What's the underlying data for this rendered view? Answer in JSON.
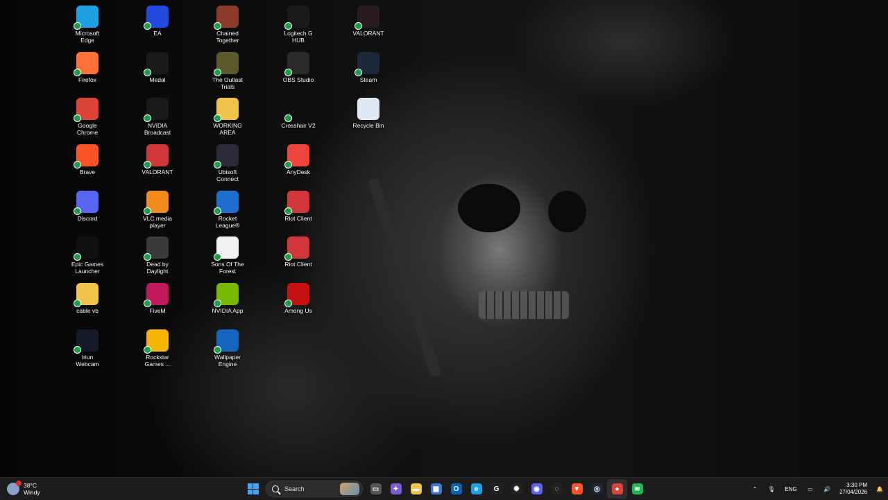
{
  "desktop": {
    "icons": [
      {
        "label": "Microsoft\nEdge",
        "icon": "edge-icon",
        "color": "#1fa0e3"
      },
      {
        "label": "Firefox",
        "icon": "firefox-icon",
        "color": "#ff7139"
      },
      {
        "label": "Google\nChrome",
        "icon": "chrome-icon",
        "color": "#db4437"
      },
      {
        "label": "Brave",
        "icon": "brave-icon",
        "color": "#fb542b"
      },
      {
        "label": "Discord",
        "icon": "discord-icon",
        "color": "#5865f2"
      },
      {
        "label": "Epic Games\nLauncher",
        "icon": "epic-games-icon",
        "color": "#111111"
      },
      {
        "label": "cable vb",
        "icon": "folder-icon",
        "color": "#f0c44a"
      },
      {
        "label": "Iriun\nWebcam",
        "icon": "webcam-icon",
        "color": "#141a2a"
      },
      {
        "label": "EA",
        "icon": "ea-icon",
        "color": "#2349e0"
      },
      {
        "label": "Medal",
        "icon": "medal-icon",
        "color": "#1a1a1a"
      },
      {
        "label": "NVIDIA\nBroadcast",
        "icon": "nvidia-broadcast-icon",
        "color": "#1a1a1a"
      },
      {
        "label": "VALORANT",
        "icon": "riot-icon",
        "color": "#d13639"
      },
      {
        "label": "VLC media\nplayer",
        "icon": "vlc-icon",
        "color": "#f28b1c"
      },
      {
        "label": "Dead by\nDaylight",
        "icon": "dead-by-daylight-icon",
        "color": "#3a3a3a"
      },
      {
        "label": "FiveM",
        "icon": "fivem-icon",
        "color": "#c2185b"
      },
      {
        "label": "Rockstar\nGames ...",
        "icon": "rockstar-icon",
        "color": "#f4b400"
      },
      {
        "label": "Chained\nTogether",
        "icon": "chained-together-icon",
        "color": "#8a3b2a"
      },
      {
        "label": "The Outlast\nTrials",
        "icon": "outlast-trials-icon",
        "color": "#5c5a2c"
      },
      {
        "label": "WORKING\nAREA",
        "icon": "folder-icon",
        "color": "#f0c44a"
      },
      {
        "label": "Ubisoft\nConnect",
        "icon": "ubisoft-icon",
        "color": "#2a2a3a"
      },
      {
        "label": "Rocket\nLeague®",
        "icon": "rocket-league-icon",
        "color": "#1f6fd1"
      },
      {
        "label": "Sons Of The\nForest",
        "icon": "file-icon",
        "color": "#f2f2f2"
      },
      {
        "label": "NVIDIA App",
        "icon": "nvidia-icon",
        "color": "#76b900"
      },
      {
        "label": "Wallpaper\nEngine",
        "icon": "wallpaper-engine-icon",
        "color": "#1565c0"
      },
      {
        "label": "Logitech G\nHUB",
        "icon": "logitech-icon",
        "color": "#1a1a1a"
      },
      {
        "label": "OBS Studio",
        "icon": "obs-icon",
        "color": "#2b2b2b"
      },
      {
        "label": "Crosshair V2",
        "icon": "crosshair-icon",
        "color": "#0f0f0f"
      },
      {
        "label": "AnyDesk",
        "icon": "anydesk-icon",
        "color": "#ef443b"
      },
      {
        "label": "Riot Client",
        "icon": "riot-icon",
        "color": "#d13639"
      },
      {
        "label": "Riot Client",
        "icon": "riot-icon",
        "color": "#d13639"
      },
      {
        "label": "Among Us",
        "icon": "among-us-icon",
        "color": "#c51111"
      },
      {
        "label": "VALORANT",
        "icon": "valorant-icon",
        "color": "#2a1a22"
      },
      {
        "label": "Steam",
        "icon": "steam-icon",
        "color": "#1b2838"
      },
      {
        "label": "Recycle Bin",
        "icon": "recycle-bin-icon",
        "color": "#dfe9f3"
      }
    ]
  },
  "taskbar": {
    "weather": {
      "temp": "38°C",
      "condition": "Windy"
    },
    "search_label": "Search",
    "pinned": [
      {
        "name": "task-view",
        "glyph": "▭",
        "color": "#555555"
      },
      {
        "name": "copilot",
        "glyph": "✦",
        "color": "#7b5cd6"
      },
      {
        "name": "file-explorer",
        "glyph": "▬",
        "color": "#f0c44a"
      },
      {
        "name": "microsoft-store",
        "glyph": "▦",
        "color": "#3a7bd5"
      },
      {
        "name": "outlook",
        "glyph": "O",
        "color": "#0a64c2"
      },
      {
        "name": "edge",
        "glyph": "e",
        "color": "#1fa0e3"
      },
      {
        "name": "logitech-ghub",
        "glyph": "G",
        "color": "#222222"
      },
      {
        "name": "steelseries",
        "glyph": "✺",
        "color": "#222222"
      },
      {
        "name": "discord",
        "glyph": "◉",
        "color": "#5865f2"
      },
      {
        "name": "crosshair",
        "glyph": "◌",
        "color": "#222222"
      },
      {
        "name": "brave",
        "glyph": "▼",
        "color": "#fb542b"
      },
      {
        "name": "steam",
        "glyph": "◎",
        "color": "#1b2838"
      },
      {
        "name": "chrome",
        "glyph": "●",
        "color": "#db4437"
      },
      {
        "name": "spotify",
        "glyph": "≋",
        "color": "#1db954"
      }
    ],
    "tray": {
      "language": "ENG",
      "time": "3:30 PM",
      "date": "27/04/2026"
    }
  }
}
